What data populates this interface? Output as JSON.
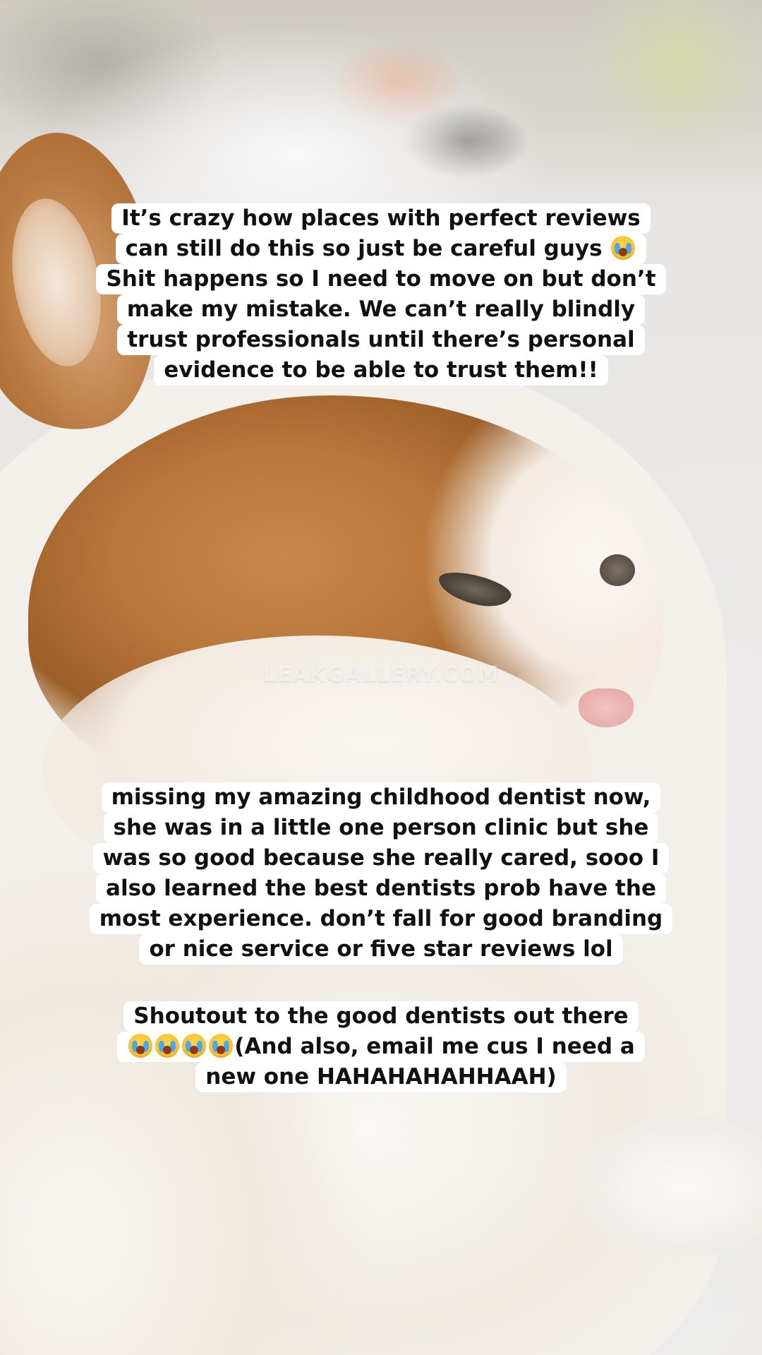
{
  "watermark": "LEAKGALLERY.COM",
  "caption_1": {
    "lines": [
      "It’s crazy how places with perfect reviews",
      "can still do this so just be careful guys",
      "Shit happens so I need to move on but don’t",
      "make my mistake. We can’t really blindly",
      "trust professionals until there’s personal",
      "evidence to be able to trust them!!"
    ],
    "emoji": "loudly-crying-face"
  },
  "caption_2": {
    "lines": [
      "missing my amazing childhood dentist now,",
      "she was in a little one person clinic but she",
      "was so good because she really cared, sooo I",
      "also learned the best dentists prob have the",
      "most experience. don’t fall for good branding",
      "or nice service or five star reviews lol"
    ]
  },
  "caption_3": {
    "lines": [
      "Shoutout to the good dentists out there",
      "(And also, email me cus I need a",
      "new one HAHAHAHAHHAAH)"
    ],
    "emoji": "loudly-crying-face",
    "emoji_count": 4
  }
}
